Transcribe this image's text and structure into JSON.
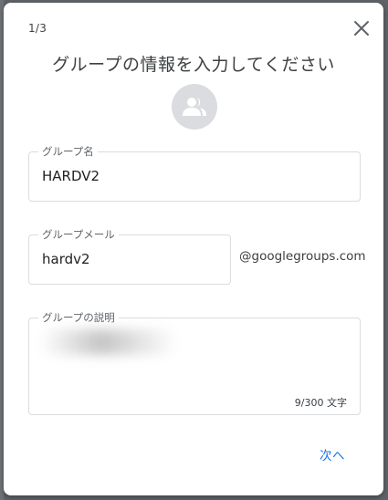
{
  "dialog": {
    "step": "1/3",
    "title": "グループの情報を入力してください",
    "close_icon": "close-icon",
    "avatar_icon": "group-icon",
    "next_label": "次へ"
  },
  "fields": {
    "group_name": {
      "label": "グループ名",
      "value": "HARDV2"
    },
    "group_email": {
      "label": "グループメール",
      "value": "hardv2",
      "suffix": "@googlegroups.com"
    },
    "group_description": {
      "label": "グループの説明",
      "counter": "9/300 文字"
    }
  },
  "colors": {
    "accent": "#1a73e8",
    "text": "#202124",
    "border": "#dadce0",
    "avatar_bg": "#dadce0"
  }
}
